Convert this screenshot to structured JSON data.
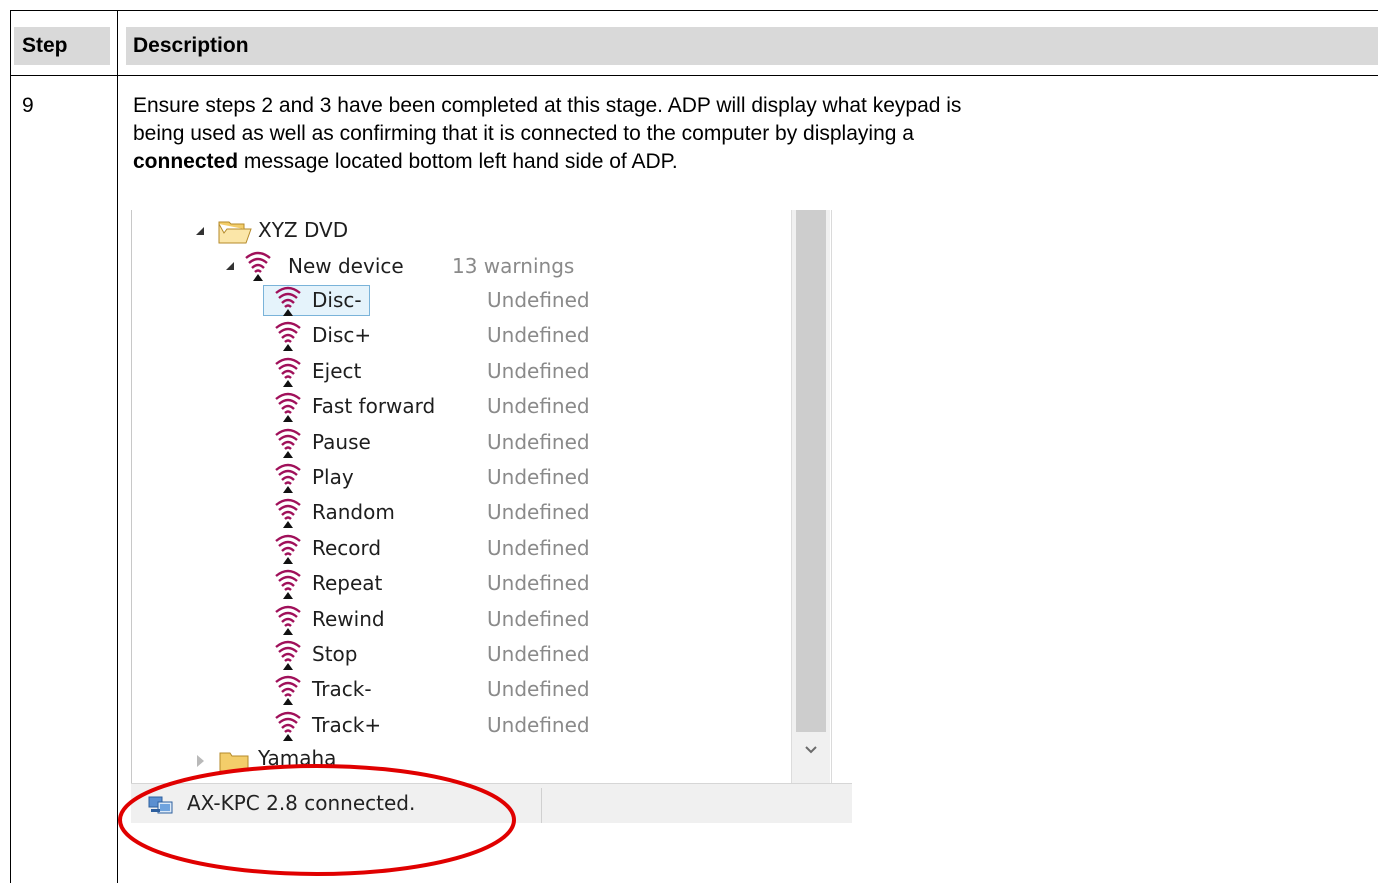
{
  "table": {
    "headers": {
      "step": "Step",
      "description": "Description"
    },
    "rows": [
      {
        "step": "9",
        "line1": "Ensure steps 2 and 3 have been completed at this stage. ADP will display what keypad is",
        "line2": "being used as well as confirming that it is connected to the computer by displaying a",
        "line3_bold": "connected",
        "line3_rest": " message located bottom left hand side of ADP."
      }
    ]
  },
  "screenshot": {
    "tree": {
      "root": {
        "label": "XYZ DVD"
      },
      "device": {
        "label": "New device",
        "status": "13 warnings"
      },
      "items": [
        {
          "label": "Disc-",
          "value": "Undefined",
          "selected": true
        },
        {
          "label": "Disc+",
          "value": "Undefined"
        },
        {
          "label": "Eject",
          "value": "Undefined"
        },
        {
          "label": "Fast forward",
          "value": "Undefined"
        },
        {
          "label": "Pause",
          "value": "Undefined"
        },
        {
          "label": "Play",
          "value": "Undefined"
        },
        {
          "label": "Random",
          "value": "Undefined"
        },
        {
          "label": "Record",
          "value": "Undefined"
        },
        {
          "label": "Repeat",
          "value": "Undefined"
        },
        {
          "label": "Rewind",
          "value": "Undefined"
        },
        {
          "label": "Stop",
          "value": "Undefined"
        },
        {
          "label": "Track-",
          "value": "Undefined"
        },
        {
          "label": "Track+",
          "value": "Undefined"
        }
      ],
      "next_folder": {
        "label": "Yamaha"
      }
    },
    "status_bar": {
      "text": "AX-KPC 2.8 connected."
    },
    "colors": {
      "signal_icon": "#a0105a",
      "selection_bg": "#e5f3fb",
      "selection_border": "#7ab3d9",
      "highlight_ellipse": "#e00000",
      "folder": "#f3cd6a"
    },
    "icons": {
      "status": "network-computer-icon",
      "node": "infrared-signal-icon",
      "folder": "folder-icon"
    }
  }
}
